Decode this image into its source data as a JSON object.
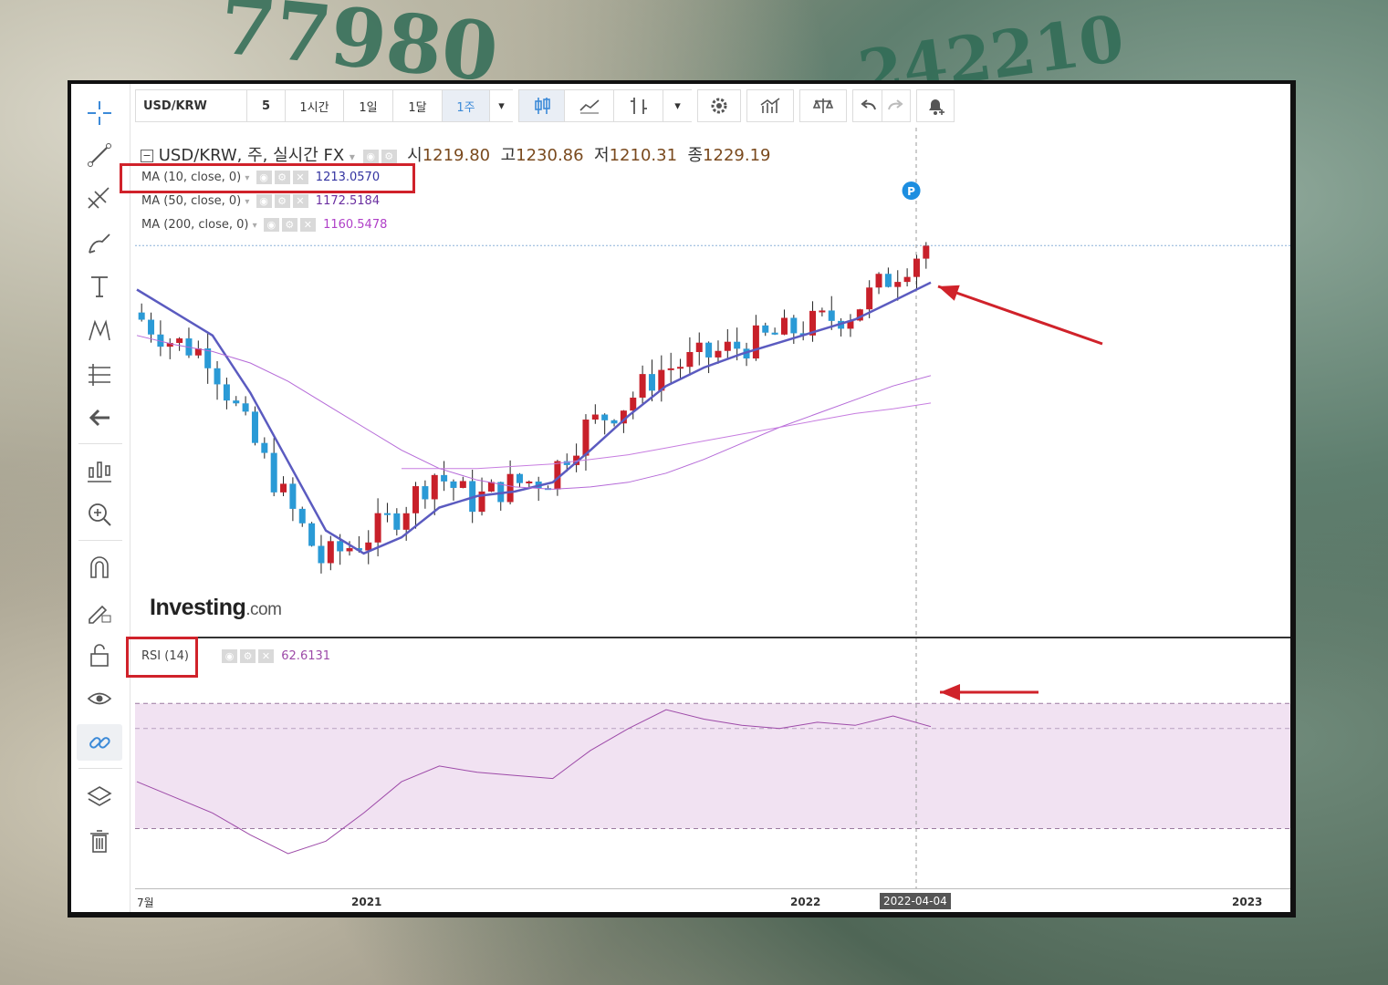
{
  "background": {
    "note_digits": "77980",
    "note_digits2": "242210"
  },
  "toolbar": {
    "symbol": "USD/KRW",
    "intervals": [
      "5",
      "1시간",
      "1일",
      "1달",
      "1주"
    ],
    "selected_interval": "1주"
  },
  "legend": {
    "title": "USD/KRW, 주, 실시간 FX",
    "open_label": "시",
    "open": "1219.80",
    "high_label": "고",
    "high": "1230.86",
    "low_label": "저",
    "low": "1210.31",
    "close_label": "종",
    "close": "1229.19",
    "ma10_label": "MA (10, close, 0)",
    "ma10_value": "1213.0570",
    "ma50_label": "MA (50, close, 0)",
    "ma50_value": "1172.5184",
    "ma200_label": "MA (200, close, 0)",
    "ma200_value": "1160.5478",
    "rsi_label": "RSI (14)",
    "rsi_value": "62.6131"
  },
  "watermark": {
    "brand": "Investing",
    "suffix": ".com"
  },
  "marker_label": "P",
  "x_axis": {
    "ticks": [
      "7월",
      "2021",
      "2022",
      "2022-04-04",
      "2023"
    ]
  },
  "colors": {
    "up": "#c8202a",
    "down": "#2a9ad6",
    "ma10": "#5b5bc0",
    "ma50": "#b56ad8",
    "ma200": "#c77de0",
    "rsi": "#9d4aa8",
    "rsi_band": "#f1e2f2",
    "annotation": "#d0222a"
  },
  "chart_data": {
    "type": "line",
    "series": [
      {
        "name": "USD/KRW",
        "x": [
          "2020-07",
          "2020-08",
          "2020-09",
          "2020-10",
          "2020-11",
          "2020-12",
          "2021-01",
          "2021-02",
          "2021-03",
          "2021-04",
          "2021-05",
          "2021-06",
          "2021-07",
          "2021-08",
          "2021-09",
          "2021-10",
          "2021-11",
          "2021-12",
          "2022-01",
          "2022-02",
          "2022-03",
          "2022-04"
        ],
        "values": [
          1200,
          1188,
          1182,
          1150,
          1120,
          1092,
          1100,
          1112,
          1130,
          1118,
          1125,
          1128,
          1150,
          1160,
          1175,
          1180,
          1185,
          1190,
          1195,
          1200,
          1215,
          1229.19
        ]
      },
      {
        "name": "MA (10, close, 0)",
        "values": [
          1210,
          1200,
          1190,
          1165,
          1135,
          1105,
          1095,
          1102,
          1115,
          1120,
          1122,
          1126,
          1140,
          1155,
          1168,
          1176,
          1182,
          1187,
          1192,
          1197,
          1205,
          1213.06
        ]
      },
      {
        "name": "MA (50, close, 0)",
        "values": [
          1190,
          1186,
          1183,
          1178,
          1170,
          1160,
          1150,
          1140,
          1132,
          1127,
          1124,
          1123,
          1124,
          1126,
          1130,
          1136,
          1143,
          1150,
          1156,
          1162,
          1168,
          1172.52
        ]
      },
      {
        "name": "MA (200, close, 0)",
        "values": [
          null,
          null,
          null,
          null,
          null,
          null,
          null,
          1132,
          1132,
          1132,
          1133,
          1134,
          1136,
          1138,
          1141,
          1144,
          1147,
          1150,
          1153,
          1156,
          1158,
          1160.55
        ]
      },
      {
        "name": "RSI (14)",
        "values": [
          45,
          40,
          35,
          28,
          22,
          26,
          35,
          45,
          50,
          48,
          47,
          46,
          55,
          62,
          68,
          65,
          63,
          62,
          64,
          63,
          66,
          62.61
        ]
      }
    ],
    "rsi_band": [
      30,
      70
    ]
  },
  "annotations": {
    "boxes": [
      "ma10-highlight",
      "rsi-highlight"
    ],
    "arrows": [
      "price-arrow",
      "rsi-arrow"
    ]
  }
}
